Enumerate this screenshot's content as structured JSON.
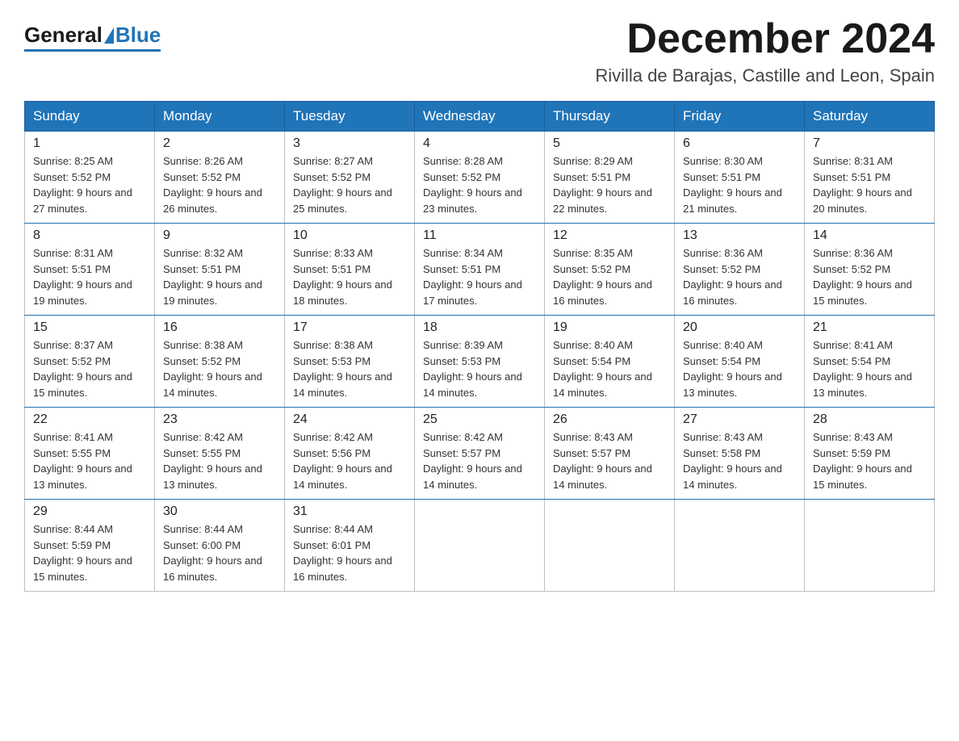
{
  "logo": {
    "general": "General",
    "blue": "Blue"
  },
  "header": {
    "month": "December 2024",
    "location": "Rivilla de Barajas, Castille and Leon, Spain"
  },
  "weekdays": [
    "Sunday",
    "Monday",
    "Tuesday",
    "Wednesday",
    "Thursday",
    "Friday",
    "Saturday"
  ],
  "weeks": [
    [
      {
        "day": "1",
        "sunrise": "8:25 AM",
        "sunset": "5:52 PM",
        "daylight": "9 hours and 27 minutes."
      },
      {
        "day": "2",
        "sunrise": "8:26 AM",
        "sunset": "5:52 PM",
        "daylight": "9 hours and 26 minutes."
      },
      {
        "day": "3",
        "sunrise": "8:27 AM",
        "sunset": "5:52 PM",
        "daylight": "9 hours and 25 minutes."
      },
      {
        "day": "4",
        "sunrise": "8:28 AM",
        "sunset": "5:52 PM",
        "daylight": "9 hours and 23 minutes."
      },
      {
        "day": "5",
        "sunrise": "8:29 AM",
        "sunset": "5:51 PM",
        "daylight": "9 hours and 22 minutes."
      },
      {
        "day": "6",
        "sunrise": "8:30 AM",
        "sunset": "5:51 PM",
        "daylight": "9 hours and 21 minutes."
      },
      {
        "day": "7",
        "sunrise": "8:31 AM",
        "sunset": "5:51 PM",
        "daylight": "9 hours and 20 minutes."
      }
    ],
    [
      {
        "day": "8",
        "sunrise": "8:31 AM",
        "sunset": "5:51 PM",
        "daylight": "9 hours and 19 minutes."
      },
      {
        "day": "9",
        "sunrise": "8:32 AM",
        "sunset": "5:51 PM",
        "daylight": "9 hours and 19 minutes."
      },
      {
        "day": "10",
        "sunrise": "8:33 AM",
        "sunset": "5:51 PM",
        "daylight": "9 hours and 18 minutes."
      },
      {
        "day": "11",
        "sunrise": "8:34 AM",
        "sunset": "5:51 PM",
        "daylight": "9 hours and 17 minutes."
      },
      {
        "day": "12",
        "sunrise": "8:35 AM",
        "sunset": "5:52 PM",
        "daylight": "9 hours and 16 minutes."
      },
      {
        "day": "13",
        "sunrise": "8:36 AM",
        "sunset": "5:52 PM",
        "daylight": "9 hours and 16 minutes."
      },
      {
        "day": "14",
        "sunrise": "8:36 AM",
        "sunset": "5:52 PM",
        "daylight": "9 hours and 15 minutes."
      }
    ],
    [
      {
        "day": "15",
        "sunrise": "8:37 AM",
        "sunset": "5:52 PM",
        "daylight": "9 hours and 15 minutes."
      },
      {
        "day": "16",
        "sunrise": "8:38 AM",
        "sunset": "5:52 PM",
        "daylight": "9 hours and 14 minutes."
      },
      {
        "day": "17",
        "sunrise": "8:38 AM",
        "sunset": "5:53 PM",
        "daylight": "9 hours and 14 minutes."
      },
      {
        "day": "18",
        "sunrise": "8:39 AM",
        "sunset": "5:53 PM",
        "daylight": "9 hours and 14 minutes."
      },
      {
        "day": "19",
        "sunrise": "8:40 AM",
        "sunset": "5:54 PM",
        "daylight": "9 hours and 14 minutes."
      },
      {
        "day": "20",
        "sunrise": "8:40 AM",
        "sunset": "5:54 PM",
        "daylight": "9 hours and 13 minutes."
      },
      {
        "day": "21",
        "sunrise": "8:41 AM",
        "sunset": "5:54 PM",
        "daylight": "9 hours and 13 minutes."
      }
    ],
    [
      {
        "day": "22",
        "sunrise": "8:41 AM",
        "sunset": "5:55 PM",
        "daylight": "9 hours and 13 minutes."
      },
      {
        "day": "23",
        "sunrise": "8:42 AM",
        "sunset": "5:55 PM",
        "daylight": "9 hours and 13 minutes."
      },
      {
        "day": "24",
        "sunrise": "8:42 AM",
        "sunset": "5:56 PM",
        "daylight": "9 hours and 14 minutes."
      },
      {
        "day": "25",
        "sunrise": "8:42 AM",
        "sunset": "5:57 PM",
        "daylight": "9 hours and 14 minutes."
      },
      {
        "day": "26",
        "sunrise": "8:43 AM",
        "sunset": "5:57 PM",
        "daylight": "9 hours and 14 minutes."
      },
      {
        "day": "27",
        "sunrise": "8:43 AM",
        "sunset": "5:58 PM",
        "daylight": "9 hours and 14 minutes."
      },
      {
        "day": "28",
        "sunrise": "8:43 AM",
        "sunset": "5:59 PM",
        "daylight": "9 hours and 15 minutes."
      }
    ],
    [
      {
        "day": "29",
        "sunrise": "8:44 AM",
        "sunset": "5:59 PM",
        "daylight": "9 hours and 15 minutes."
      },
      {
        "day": "30",
        "sunrise": "8:44 AM",
        "sunset": "6:00 PM",
        "daylight": "9 hours and 16 minutes."
      },
      {
        "day": "31",
        "sunrise": "8:44 AM",
        "sunset": "6:01 PM",
        "daylight": "9 hours and 16 minutes."
      },
      null,
      null,
      null,
      null
    ]
  ],
  "labels": {
    "sunrise": "Sunrise:",
    "sunset": "Sunset:",
    "daylight": "Daylight:"
  }
}
